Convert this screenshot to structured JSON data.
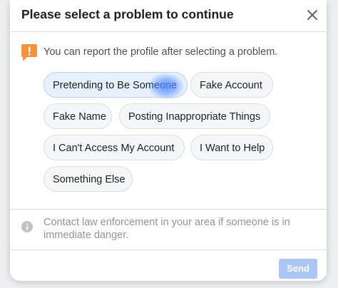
{
  "dialog": {
    "title": "Please select a problem to continue",
    "notice": "You can report the profile after selecting a problem.",
    "options": [
      {
        "label": "Pretending to Be Someone",
        "selected": true
      },
      {
        "label": "Fake Account",
        "selected": false
      },
      {
        "label": "Fake Name",
        "selected": false
      },
      {
        "label": "Posting Inappropriate Things",
        "selected": false
      },
      {
        "label": "I Can't Access My Account",
        "selected": false
      },
      {
        "label": "I Want to Help",
        "selected": false
      },
      {
        "label": "Something Else",
        "selected": false
      }
    ],
    "info": "Contact law enforcement in your area if someone is in immediate danger.",
    "send_label": "Send",
    "icons": {
      "close": "close-icon",
      "warning": "warning-flag-icon",
      "info": "info-icon"
    },
    "colors": {
      "warning": "#f7923b",
      "selected_chip": "#e7f0fd",
      "send_disabled": "#a9c6f5"
    }
  }
}
